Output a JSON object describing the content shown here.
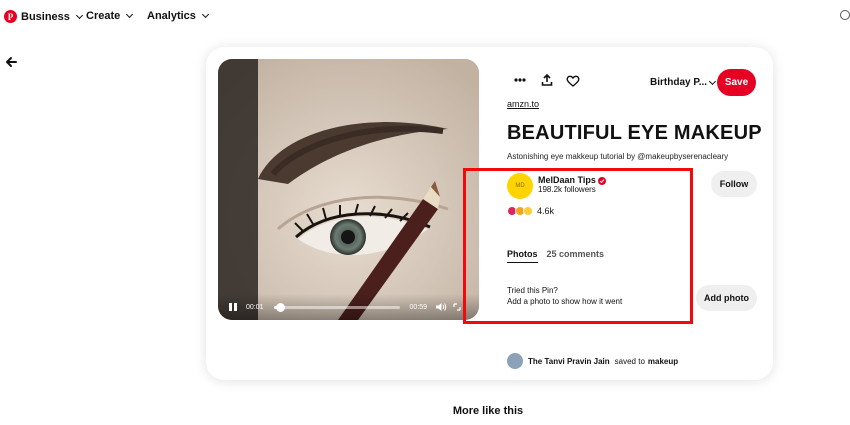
{
  "nav": {
    "logo": "P",
    "business": "Business",
    "create": "Create",
    "analytics": "Analytics"
  },
  "pin": {
    "video": {
      "time_current": "00:01",
      "time_total": "00:59",
      "progress": 0.05
    },
    "board": "Birthday P...",
    "save_label": "Save",
    "link": "amzn.to",
    "title": "BEAUTIFUL EYE MAKEUP",
    "description": "Astonishing eye makkeup tutorial by @makeupbyserenacleary",
    "creator": {
      "avatar_text": "MD",
      "name": "MelDaan Tips",
      "followers": "198.2k followers",
      "follow_label": "Follow"
    },
    "reactions": {
      "count": "4.6k"
    },
    "tabs": {
      "photos": "Photos",
      "comments": "25 comments"
    },
    "tried": {
      "line1": "Tried this Pin?",
      "line2": "Add a photo to show how it went",
      "button": "Add photo"
    },
    "saved_by": {
      "name": "The Tanvi Pravin Jain",
      "text": "saved to",
      "board": "makeup"
    }
  },
  "more_like_this": "More like this",
  "colors": {
    "accent": "#e60023",
    "highlight": "#f20a0a"
  }
}
